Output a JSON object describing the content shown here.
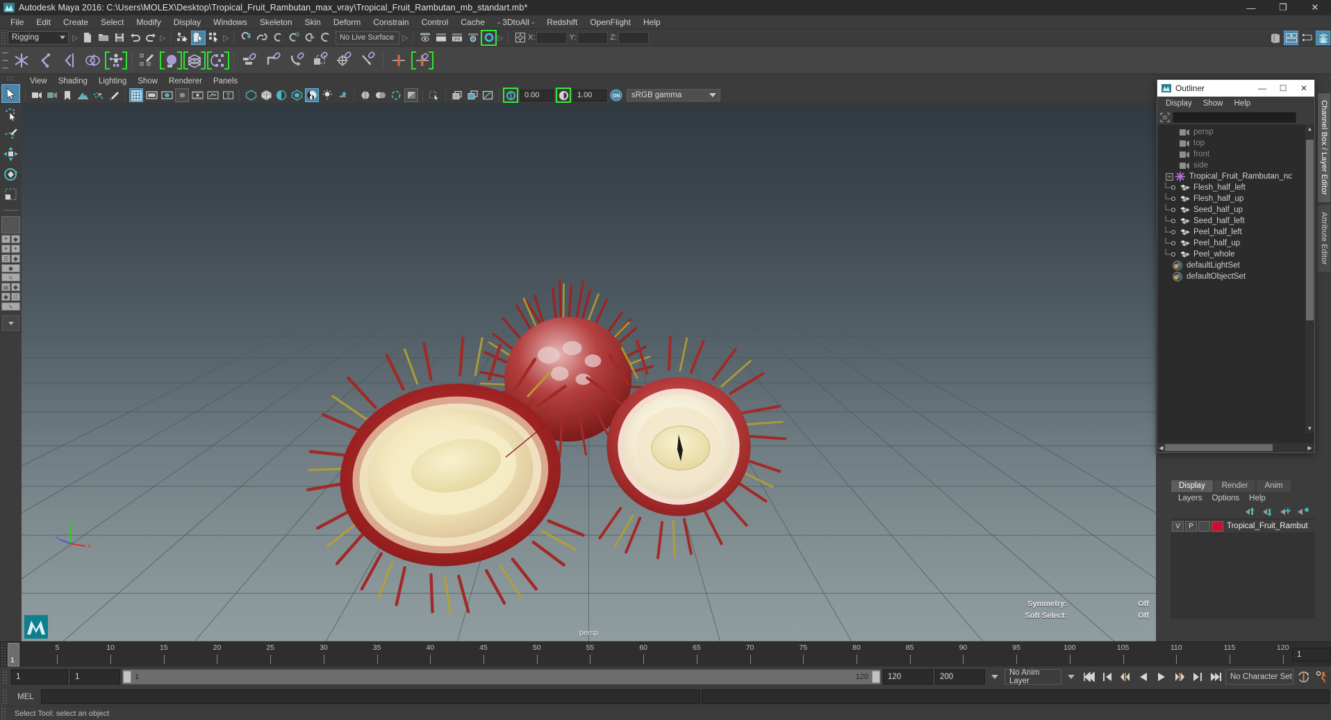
{
  "window": {
    "title": "Autodesk Maya 2016: C:\\Users\\MOLEX\\Desktop\\Tropical_Fruit_Rambutan_max_vray\\Tropical_Fruit_Rambutan_mb_standart.mb*",
    "app_icon": "maya-logo-icon",
    "minimize": "—",
    "maximize": "❐",
    "close": "✕"
  },
  "menubar": {
    "items": [
      "File",
      "Edit",
      "Create",
      "Select",
      "Modify",
      "Display",
      "Windows",
      "Skeleton",
      "Skin",
      "Deform",
      "Constrain",
      "Control",
      "Cache",
      "- 3DtoAll -",
      "Redshift",
      "OpenFlight",
      "Help"
    ]
  },
  "statusline": {
    "menu_set": "Rigging",
    "live_surface": "No Live Surface",
    "coords": {
      "x_label": "X:",
      "y_label": "Y:",
      "z_label": "Z:",
      "x_value": "",
      "y_value": "",
      "z_value": ""
    }
  },
  "shelf": {
    "tab": "Rigging"
  },
  "viewport_menubar": {
    "items": [
      "View",
      "Shading",
      "Lighting",
      "Show",
      "Renderer",
      "Panels"
    ]
  },
  "viewport_toolbar": {
    "exposure_value": "0.00",
    "gamma_value": "1.00",
    "color_management": "sRGB gamma",
    "cm_toggle_label": "ON"
  },
  "viewport": {
    "camera_label": "persp",
    "hud": [
      {
        "label": "Symmetry:",
        "value": "Off"
      },
      {
        "label": "Soft Select:",
        "value": "Off"
      }
    ],
    "axis": {
      "x": "x",
      "y": "y",
      "z": "z"
    }
  },
  "outliner": {
    "title": "Outliner",
    "menus": [
      "Display",
      "Show",
      "Help"
    ],
    "search_value": "",
    "items": [
      {
        "label": "persp",
        "icon": "camera-icon",
        "type": "camera",
        "indent": 2,
        "dim": true
      },
      {
        "label": "top",
        "icon": "camera-icon",
        "type": "camera",
        "indent": 2,
        "dim": true
      },
      {
        "label": "front",
        "icon": "camera-icon",
        "type": "camera",
        "indent": 2,
        "dim": true
      },
      {
        "label": "side",
        "icon": "camera-icon",
        "type": "camera",
        "indent": 2,
        "dim": true
      },
      {
        "label": "Tropical_Fruit_Rambutan_nc",
        "icon": "group-icon",
        "type": "group",
        "indent": 0,
        "dim": false,
        "expanded": true
      },
      {
        "label": "Flesh_half_left",
        "icon": "mesh-icon",
        "type": "mesh",
        "indent": 2,
        "dim": false
      },
      {
        "label": "Flesh_half_up",
        "icon": "mesh-icon",
        "type": "mesh",
        "indent": 2,
        "dim": false
      },
      {
        "label": "Seed_half_up",
        "icon": "mesh-icon",
        "type": "mesh",
        "indent": 2,
        "dim": false
      },
      {
        "label": "Seed_half_left",
        "icon": "mesh-icon",
        "type": "mesh",
        "indent": 2,
        "dim": false
      },
      {
        "label": "Peel_half_left",
        "icon": "mesh-icon",
        "type": "mesh",
        "indent": 2,
        "dim": false
      },
      {
        "label": "Peel_half_up",
        "icon": "mesh-icon",
        "type": "mesh",
        "indent": 2,
        "dim": false
      },
      {
        "label": "Peel_whole",
        "icon": "mesh-icon",
        "type": "mesh",
        "indent": 2,
        "dim": false
      },
      {
        "label": "defaultLightSet",
        "icon": "set-icon",
        "type": "set",
        "indent": 1,
        "dim": false
      },
      {
        "label": "defaultObjectSet",
        "icon": "set-icon",
        "type": "set",
        "indent": 1,
        "dim": false
      }
    ]
  },
  "layer_editor": {
    "tabs": [
      "Display",
      "Render",
      "Anim"
    ],
    "selected_tab": "Display",
    "menus": [
      "Layers",
      "Options",
      "Help"
    ],
    "layers": [
      {
        "visibility": "V",
        "playback": "P",
        "shading": "",
        "color": "#c41230",
        "name": "Tropical_Fruit_Rambut"
      }
    ]
  },
  "side_tabs": {
    "items": [
      "Channel Box / Layer Editor",
      "Attribute Editor"
    ],
    "selected": "Channel Box / Layer Editor"
  },
  "timeline": {
    "current_frame": "1",
    "ticks": [
      5,
      10,
      15,
      20,
      25,
      30,
      35,
      40,
      45,
      50,
      55,
      60,
      65,
      70,
      75,
      80,
      85,
      90,
      95,
      100,
      105,
      110,
      115,
      120
    ],
    "start": 1,
    "end": 120,
    "current_frame_field": "1"
  },
  "range": {
    "anim_start": "1",
    "range_start": "1",
    "slider_start_label": "1",
    "slider_end_label": "120",
    "range_end": "120",
    "anim_end": "200",
    "anim_layer": "No Anim Layer",
    "character_set": "No Character Set"
  },
  "mel": {
    "label": "MEL",
    "command_value": "",
    "output_value": ""
  },
  "helpline": {
    "text": "Select Tool: select an object"
  },
  "colors": {
    "accent_blue": "#4a86a8",
    "green_outline": "#33ee33",
    "layer_red": "#c41230",
    "panel_bg": "#3c3c3c",
    "dark_bg": "#2b2b2b"
  }
}
